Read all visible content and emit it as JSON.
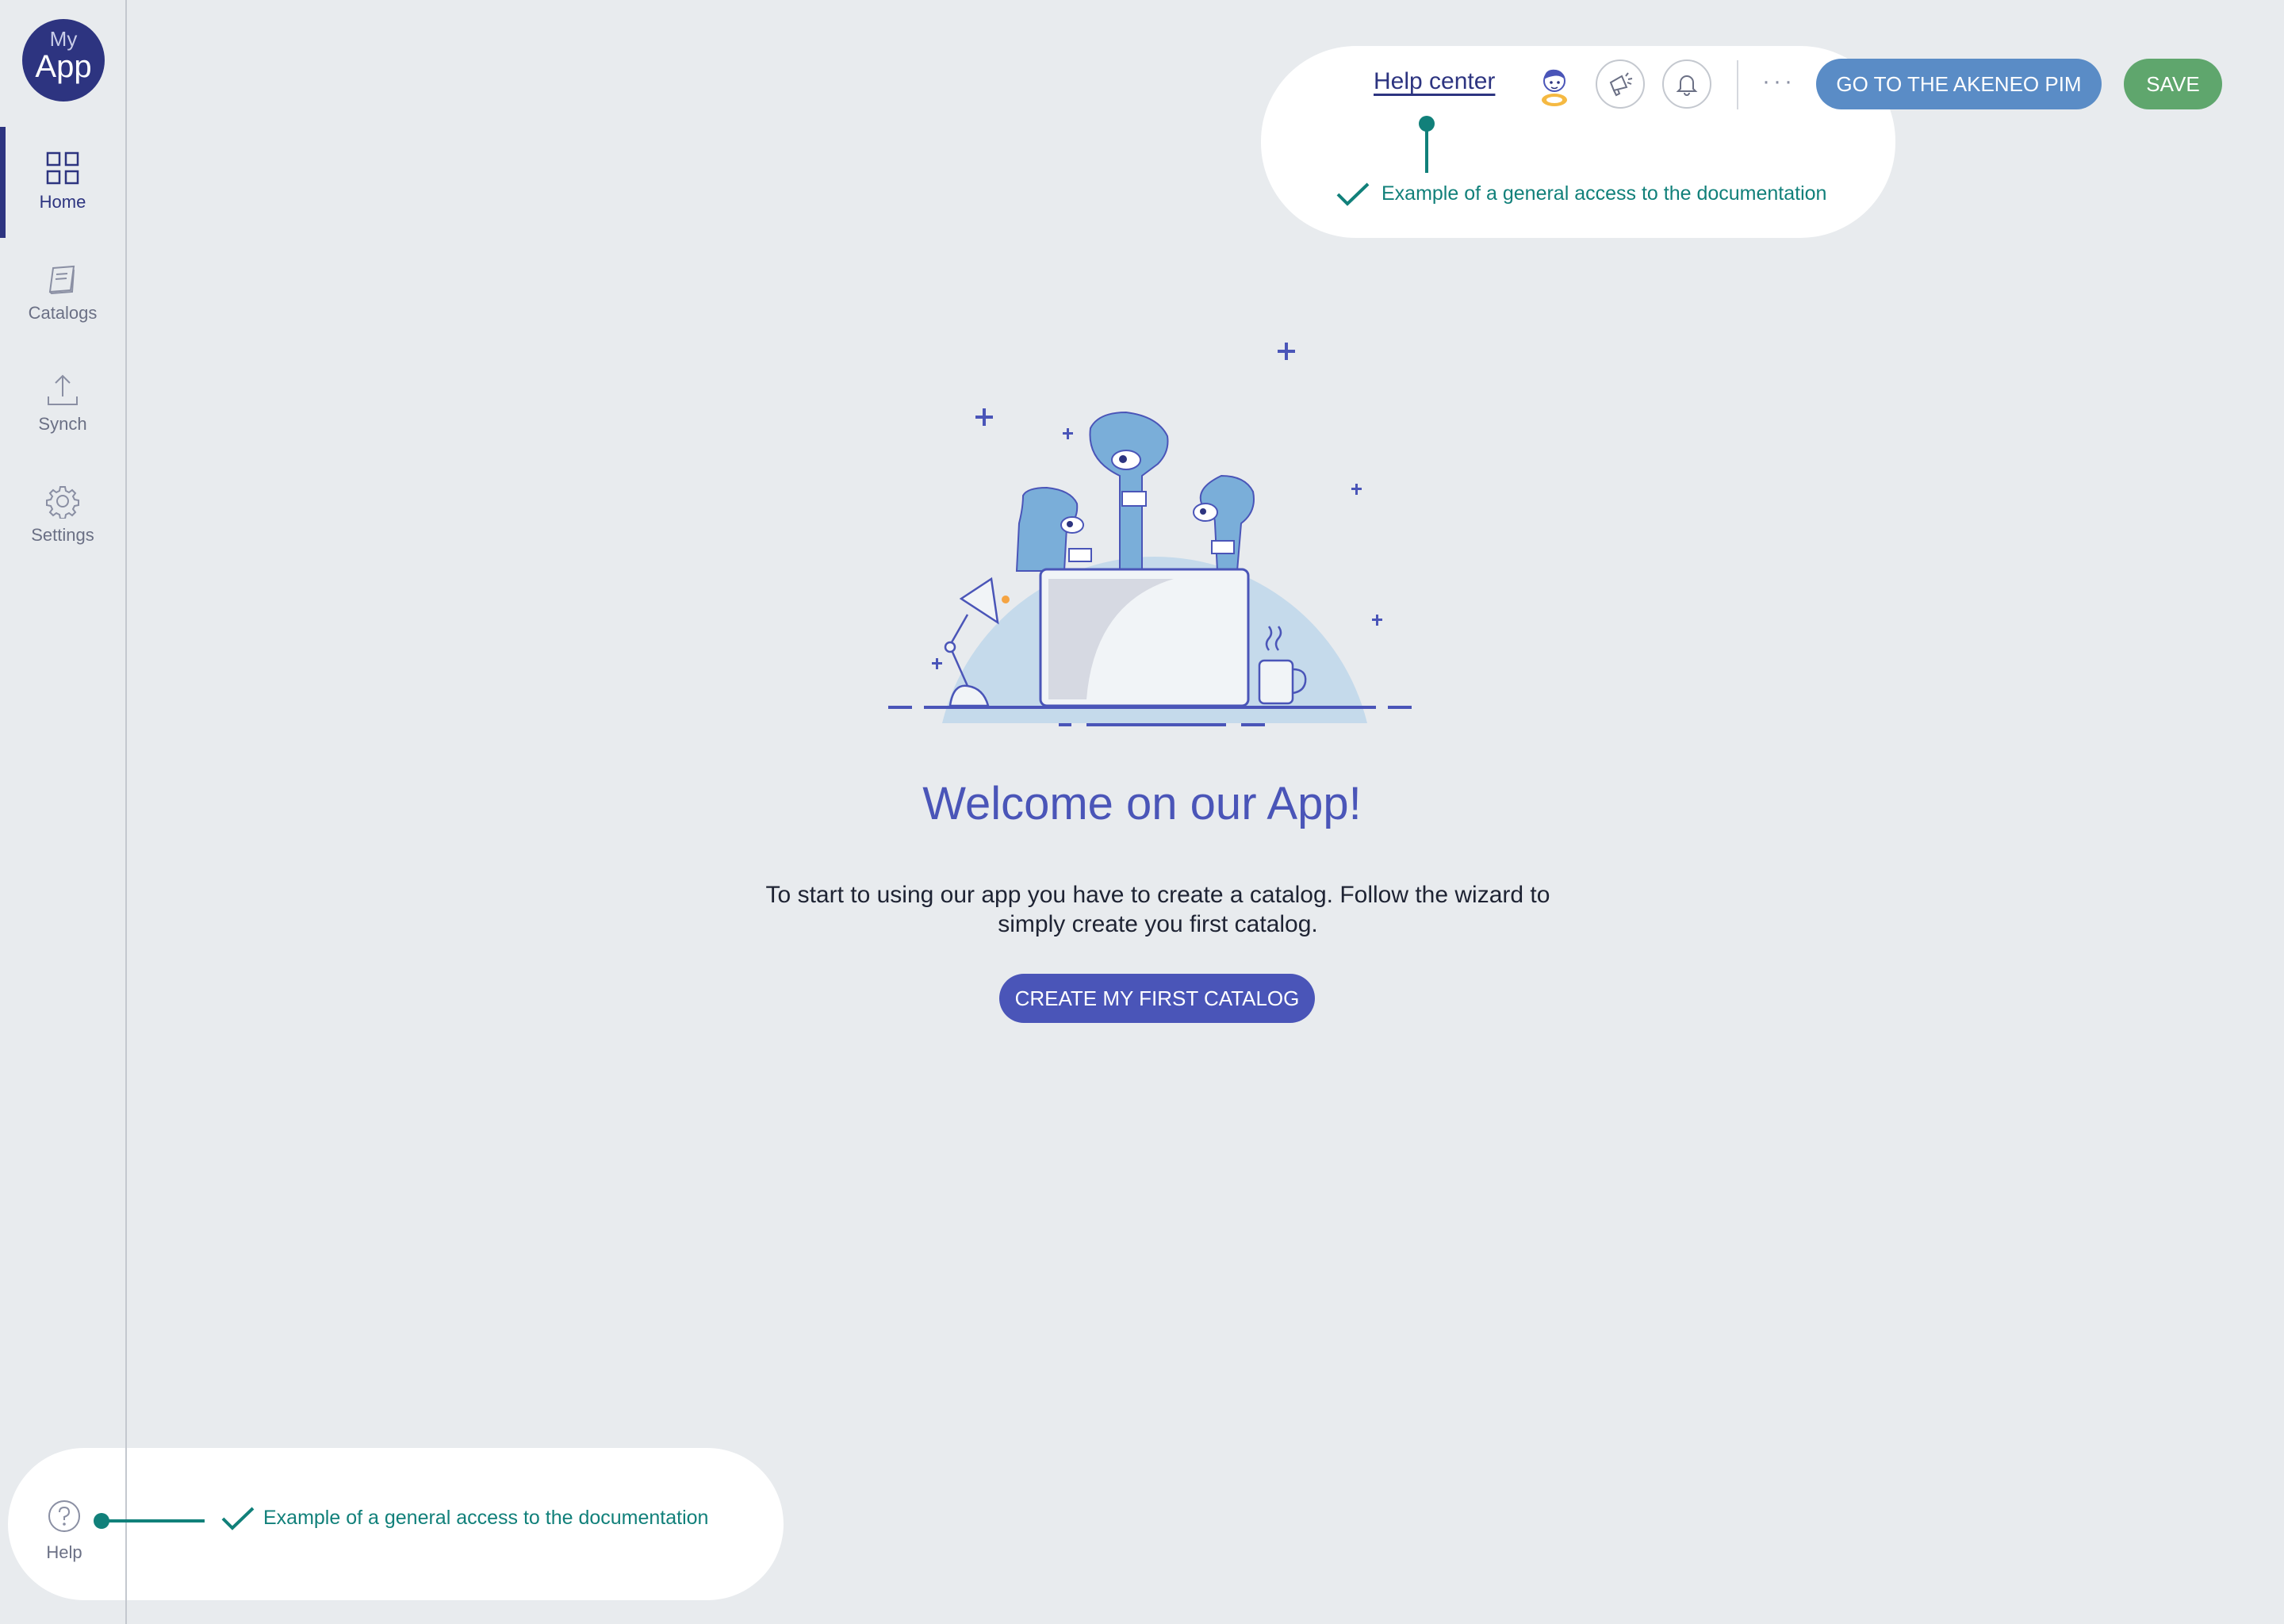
{
  "logo": {
    "line1": "My",
    "line2": "App"
  },
  "sidebar": {
    "items": [
      {
        "label": "Home",
        "icon": "grid-icon",
        "active": true
      },
      {
        "label": "Catalogs",
        "icon": "book-icon",
        "active": false
      },
      {
        "label": "Synch",
        "icon": "upload-icon",
        "active": false
      },
      {
        "label": "Settings",
        "icon": "gear-icon",
        "active": false
      }
    ],
    "help": {
      "label": "Help",
      "icon": "question-circle-icon"
    }
  },
  "header": {
    "help_center": "Help center",
    "more": "···",
    "akeneo_button": "GO TO THE AKENEO PIM",
    "save_button": "SAVE"
  },
  "annotations": {
    "top": "Example of a general access to the documentation",
    "bottom": "Example of a general access to the documentation"
  },
  "main": {
    "welcome_title": "Welcome on our App!",
    "intro_line1": "To start to using our app you have to create a catalog. Follow the wizard to",
    "intro_line2": "simply create you first catalog.",
    "create_button": "CREATE MY FIRST CATALOG"
  },
  "colors": {
    "brand": "#2d3480",
    "primary": "#4a55b8",
    "akeneo": "#5a8cc6",
    "save": "#5fa66d",
    "annotation": "#11807a"
  }
}
